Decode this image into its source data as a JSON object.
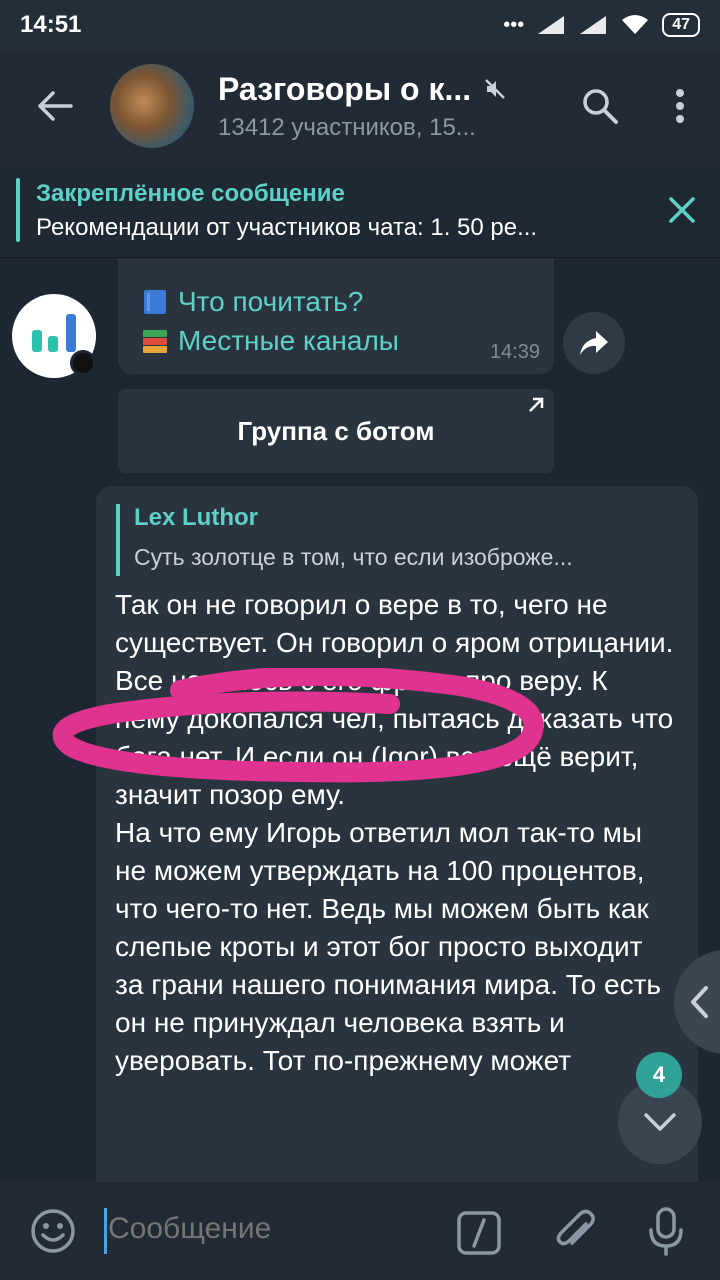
{
  "status": {
    "time": "14:51",
    "battery": "47"
  },
  "header": {
    "title": "Разговоры о к...",
    "subtitle": "13412 участников, 15..."
  },
  "pinned": {
    "title": "Закреплённое сообщение",
    "text": "Рекомендации от участников чата:  1. 50 ре..."
  },
  "links": {
    "line1": "Что почитать?",
    "line2": "Местные каналы",
    "time": "14:39"
  },
  "inline_button": {
    "label": "Группа с ботом"
  },
  "message": {
    "reply_name": "Lex Luthor",
    "reply_text": "Суть золотце в том, что если изоброже...",
    "paragraphs": [
      "Так он не говорил о вере в то, чего не существует. Он говорил о яром отрицании.",
      "Все началось с его фразы про веру. К нему докопался чел, пытаясь доказать что бога нет. И если он (Igor) все ещё верит, значит позор ему.",
      "На что ему Игорь ответил мол так-то мы не можем утверждать на 100 процентов, что чего-то нет. Ведь мы можем быть как слепые кроты и этот бог просто выходит за грани нашего понимания мира. То есть он не принуждал человека взять и уверовать. Тот по-прежнему может"
    ]
  },
  "unread_count": "4",
  "input": {
    "placeholder": "Сообщение"
  },
  "colors": {
    "accent": "#5ed1c6",
    "background": "#1d2733",
    "bubble": "#2a343f",
    "header": "#222b35",
    "scribble": "#e0338f"
  }
}
